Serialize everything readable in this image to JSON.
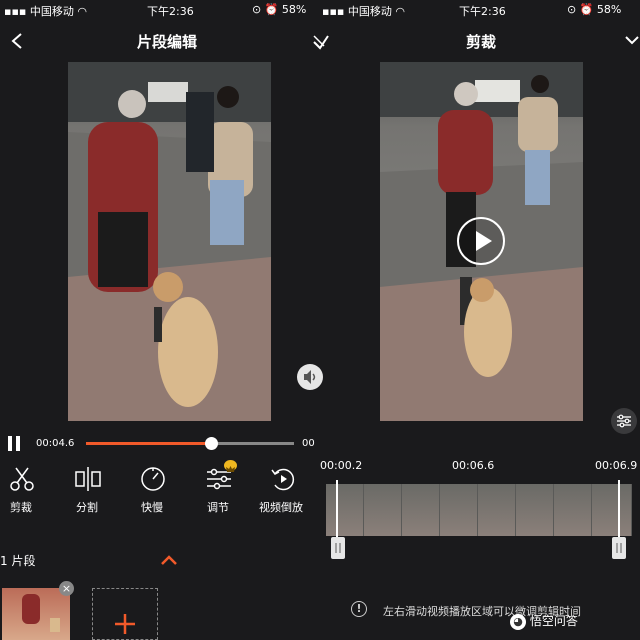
{
  "left_status": {
    "carrier": "中国移动",
    "time": "下午2:36",
    "battery": "58%"
  },
  "right_status": {
    "carrier": "中国移动",
    "time": "下午2:36",
    "battery": "58%"
  },
  "left_screen": {
    "title": "片段编辑",
    "current_time": "00:04.6",
    "end_time_partial": "00",
    "progress_fraction": 0.6,
    "tools": [
      {
        "label": "剪裁",
        "icon": "scissors-icon"
      },
      {
        "label": "分割",
        "icon": "split-icon"
      },
      {
        "label": "快慢",
        "icon": "speed-icon"
      },
      {
        "label": "调节",
        "icon": "adjust-icon"
      },
      {
        "label": "视频倒放",
        "icon": "reverse-icon"
      }
    ],
    "clip_count_label": "1 片段"
  },
  "right_screen": {
    "title": "剪裁",
    "timeline_start": "00:00.2",
    "timeline_mid": "00:06.6",
    "timeline_end": "00:06.9",
    "hint": "左右滑动视频播放区域可以微调剪辑时间",
    "watermark": "悟空问答"
  },
  "colors": {
    "accent": "#f25a2a",
    "background": "#1a1a1c",
    "gold_badge": "#f0b820"
  }
}
